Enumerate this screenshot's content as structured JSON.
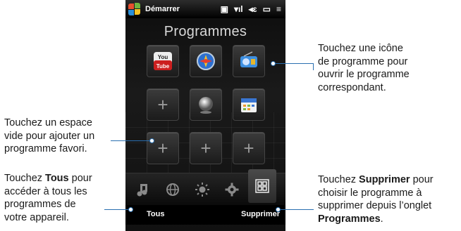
{
  "statusbar": {
    "title": "Démarrer"
  },
  "screen": {
    "title": "Programmes"
  },
  "softkeys": {
    "left": "Tous",
    "right": "Supprimer"
  },
  "callouts": {
    "top_right": [
      "Touchez une icône",
      "de programme pour",
      "ouvrir le programme",
      "correspondant."
    ],
    "mid_left": [
      "Touchez un espace",
      "vide pour ajouter un",
      "programme favori."
    ],
    "bottom_left": {
      "pre1": "Touchez ",
      "bold": "Tous",
      "post1": " pour",
      "l2": "accéder à tous les",
      "l3": "programmes de",
      "l4": "votre appareil."
    },
    "bottom_right": {
      "pre1": "Touchez ",
      "bold1": "Supprimer",
      "post1": " pour",
      "l2": "choisir le programme à",
      "l3": "supprimer depuis l’onglet",
      "bold2": "Programmes",
      "post4": "."
    }
  },
  "colors": {
    "accent_line": "#2a6fb0",
    "background": "#0d0d0d"
  },
  "icons": [
    "windows-logo",
    "youtube-icon",
    "compass-icon",
    "radio-icon",
    "plus-icon",
    "globe-ball-icon",
    "calendar-icon",
    "music-note-icon",
    "internet-globe-icon",
    "weather-sun-icon",
    "settings-gear-icon",
    "programs-grid-icon"
  ]
}
